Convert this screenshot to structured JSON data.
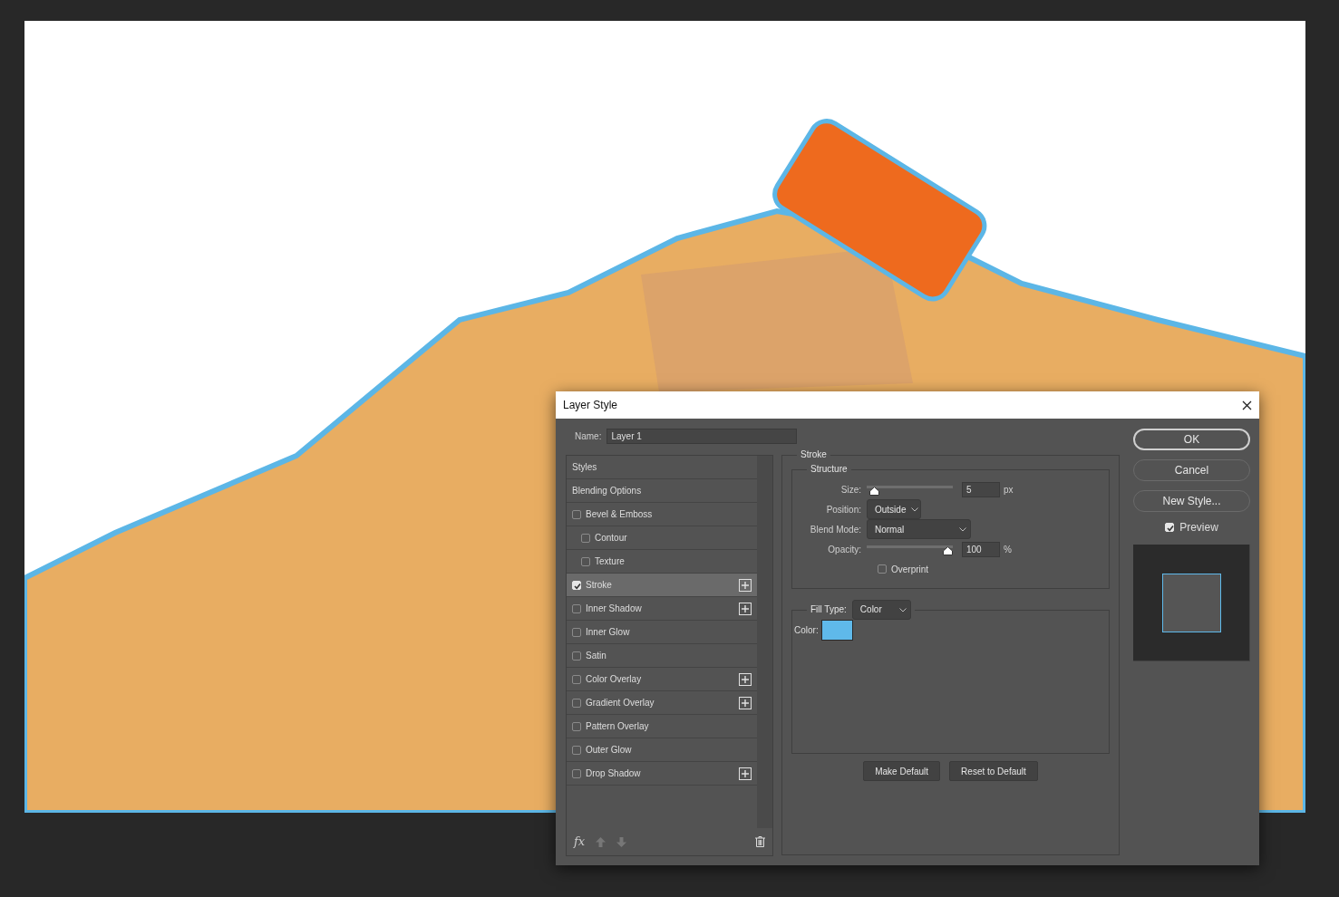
{
  "window": {
    "title": "Layer Style"
  },
  "name_field": {
    "label": "Name:",
    "value": "Layer 1"
  },
  "styles_list": [
    {
      "kind": "header",
      "label": "Styles",
      "selected": false
    },
    {
      "kind": "header",
      "label": "Blending Options",
      "selected": false
    },
    {
      "kind": "effect",
      "label": "Bevel & Emboss",
      "checked": false,
      "selected": false,
      "addable": false
    },
    {
      "kind": "sub",
      "label": "Contour",
      "checked": false,
      "selected": false,
      "addable": false
    },
    {
      "kind": "sub",
      "label": "Texture",
      "checked": false,
      "selected": false,
      "addable": false
    },
    {
      "kind": "effect",
      "label": "Stroke",
      "checked": true,
      "selected": true,
      "addable": true
    },
    {
      "kind": "effect",
      "label": "Inner Shadow",
      "checked": false,
      "selected": false,
      "addable": true
    },
    {
      "kind": "effect",
      "label": "Inner Glow",
      "checked": false,
      "selected": false,
      "addable": false
    },
    {
      "kind": "effect",
      "label": "Satin",
      "checked": false,
      "selected": false,
      "addable": false
    },
    {
      "kind": "effect",
      "label": "Color Overlay",
      "checked": false,
      "selected": false,
      "addable": true
    },
    {
      "kind": "effect",
      "label": "Gradient Overlay",
      "checked": false,
      "selected": false,
      "addable": true
    },
    {
      "kind": "effect",
      "label": "Pattern Overlay",
      "checked": false,
      "selected": false,
      "addable": false
    },
    {
      "kind": "effect",
      "label": "Outer Glow",
      "checked": false,
      "selected": false,
      "addable": false
    },
    {
      "kind": "effect",
      "label": "Drop Shadow",
      "checked": false,
      "selected": false,
      "addable": true
    }
  ],
  "list_footer": {
    "fx": "fx"
  },
  "stroke_panel": {
    "title": "Stroke",
    "structure_title": "Structure",
    "size": {
      "label": "Size:",
      "level": 0.03,
      "value": "5",
      "unit": "px"
    },
    "position": {
      "label": "Position:",
      "value": "Outside"
    },
    "blend_mode": {
      "label": "Blend Mode:",
      "value": "Normal"
    },
    "opacity": {
      "label": "Opacity:",
      "level": 1,
      "value": "100",
      "unit": "%"
    },
    "overprint": {
      "label": "Overprint",
      "checked": false
    },
    "fill_type": {
      "label": "Fill Type:",
      "value": "Color"
    },
    "color": {
      "label": "Color:",
      "color": "#5fb9ea"
    }
  },
  "default_buttons": [
    "Make Default",
    "Reset to Default"
  ],
  "buttons": [
    {
      "label": "OK",
      "primary": true
    },
    {
      "label": "Cancel",
      "primary": false
    },
    {
      "label": "New Style...",
      "primary": false
    }
  ],
  "preview": {
    "label": "Preview",
    "checked": true
  }
}
